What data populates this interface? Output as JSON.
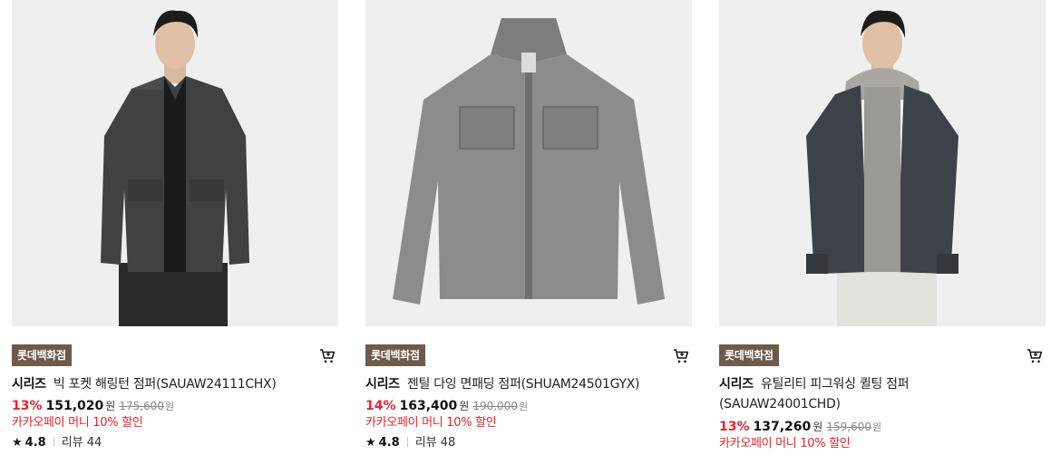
{
  "products": [
    {
      "badge": "롯데백화점",
      "brand": "시리즈",
      "name": "빅 포켓 해링턴 점퍼(SAUAW24111CHX)",
      "discount": "13%",
      "price": "151,020",
      "price_unit": "원",
      "original_price": "175,600",
      "original_unit": "원",
      "pay_promo": "카카오페이 머니 10% 할인",
      "rating": "4.8",
      "reviews": "리뷰 44",
      "image_icon": "model-wearing-dark-harrington-jacket"
    },
    {
      "badge": "롯데백화점",
      "brand": "시리즈",
      "name": "젠틸 다잉 면패딩 점퍼(SHUAM24501GYX)",
      "discount": "14%",
      "price": "163,400",
      "price_unit": "원",
      "original_price": "190,000",
      "original_unit": "원",
      "pay_promo": "카카오페이 머니 10% 할인",
      "rating": "4.8",
      "reviews": "리뷰 48",
      "image_icon": "grey-padded-field-jacket"
    },
    {
      "badge": "롯데백화점",
      "brand": "시리즈",
      "name": "유틸리티 피그워싱 퀼팅 점퍼",
      "name_line2": "(SAUAW24001CHD)",
      "discount": "13%",
      "price": "137,260",
      "price_unit": "원",
      "original_price": "159,600",
      "original_unit": "원",
      "pay_promo": "카카오페이 머니 10% 할인",
      "image_icon": "model-wearing-quilted-jacket-with-hoodie"
    }
  ],
  "colors": {
    "badge_bg": "#6e5a4a",
    "discount": "#e5262d",
    "image_bg": "#f0f0f0"
  }
}
